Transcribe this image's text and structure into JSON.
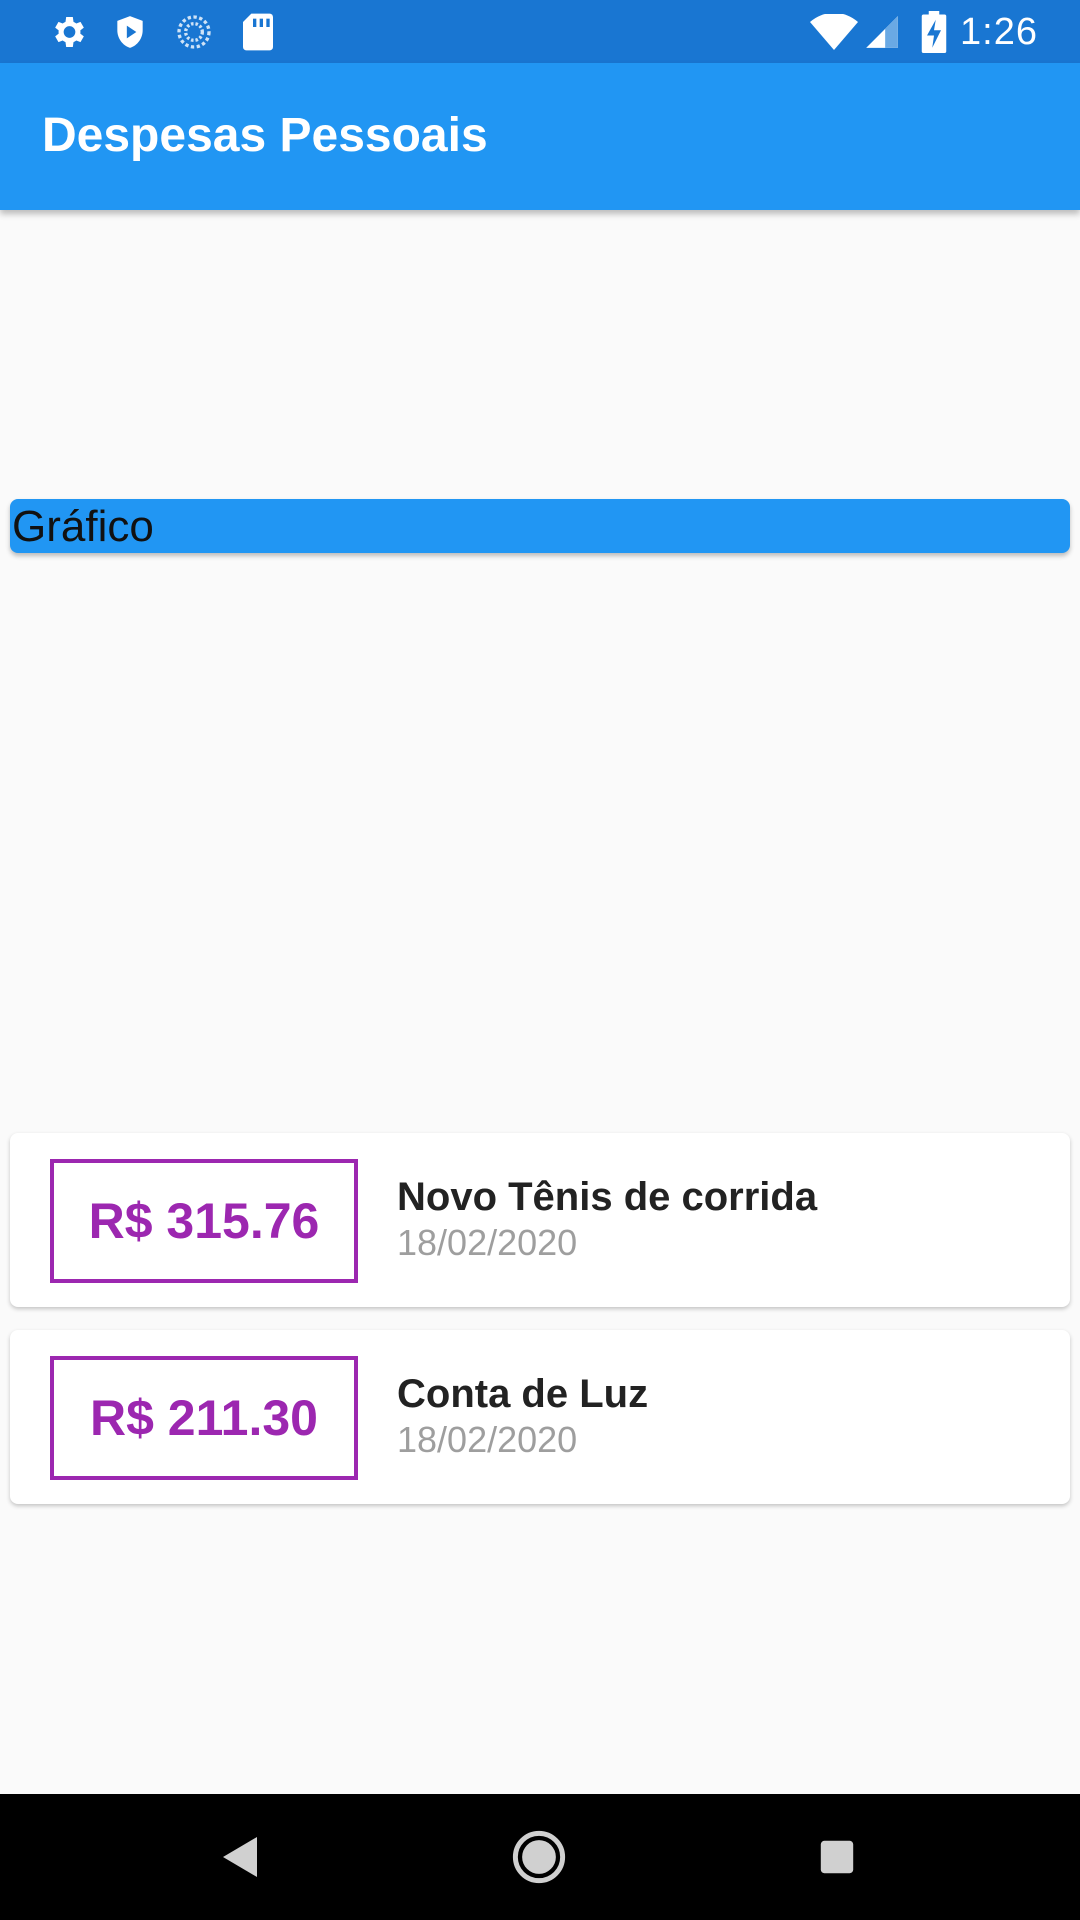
{
  "status_bar": {
    "time": "1:26",
    "left_icons": [
      "gear-icon",
      "shield-icon",
      "sync-icon",
      "sd-card-icon"
    ],
    "right_icons": [
      "wifi-icon",
      "cell-signal-icon",
      "battery-charging-icon"
    ]
  },
  "app_bar": {
    "title": "Despesas Pessoais"
  },
  "chart": {
    "label": "Gráfico"
  },
  "transactions": [
    {
      "amount": "R$ 315.76",
      "title": "Novo Tênis de corrida",
      "date": "18/02/2020"
    },
    {
      "amount": "R$ 211.30",
      "title": "Conta de Luz",
      "date": "18/02/2020"
    }
  ],
  "nav_bar": {
    "buttons": [
      "back-icon",
      "home-icon",
      "recents-icon"
    ]
  },
  "colors": {
    "status_bar": "#1976d2",
    "primary": "#2196f3",
    "accent": "#9c27b0",
    "background": "#fafafa"
  }
}
